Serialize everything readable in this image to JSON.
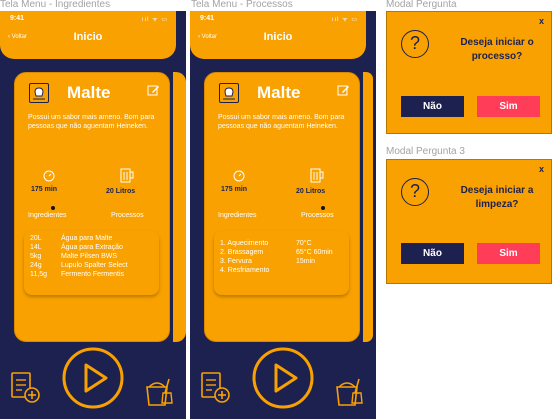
{
  "frames": {
    "f1": "Tela Menu - Ingredientes",
    "f2": "Tela Menu - Processos",
    "f3": "Modal Pergunta",
    "f4": "Modal Pergunta 3"
  },
  "status": {
    "time": "9:41",
    "signal": "ııl ᯤ ▭"
  },
  "nav": {
    "back": "‹ Voltar",
    "title": "Inicio"
  },
  "recipe": {
    "title": "Malte",
    "description": "Possui um sabor mais ameno. Bom para pessoas que não aguentam Heineken.",
    "time": "175 min",
    "volume": "20 Litros"
  },
  "tabs": {
    "ingredients": "Ingredientes",
    "processes": "Processos"
  },
  "ingredients": [
    {
      "qty": "20L",
      "name": "Água para Malte"
    },
    {
      "qty": "14L",
      "name": "Água para Extração"
    },
    {
      "qty": "5kg",
      "name": "Malte Pilsen BWS"
    },
    {
      "qty": "24g",
      "name": "Lupulo Spalter Select"
    },
    {
      "qty": "11,5g",
      "name": "Fermento Fermentis"
    }
  ],
  "processes": [
    {
      "step": "1. Aquecimento",
      "detail": "70°C"
    },
    {
      "step": "2. Brassagem",
      "detail": "65°C  60min"
    },
    {
      "step": "3. Fervura",
      "detail": "15min"
    },
    {
      "step": "4. Resfriamento",
      "detail": ""
    }
  ],
  "modal1": {
    "close": "x",
    "icon": "?",
    "question": "Deseja iniciar o processo?",
    "no": "Não",
    "yes": "Sim"
  },
  "modal2": {
    "close": "x",
    "icon": "?",
    "question": "Deseja iniciar a limpeza?",
    "no": "Não",
    "yes": "Sim"
  },
  "icons": {
    "recipe": "recipe-book-icon",
    "edit": "edit-pencil-icon",
    "timer": "timer-icon",
    "beer": "beer-mug-icon",
    "add": "add-recipe-icon",
    "play": "play-icon",
    "clean": "cleaning-bucket-icon"
  },
  "colors": {
    "primary": "#f9a101",
    "dark": "#1d2150",
    "danger": "#ff3d58"
  }
}
